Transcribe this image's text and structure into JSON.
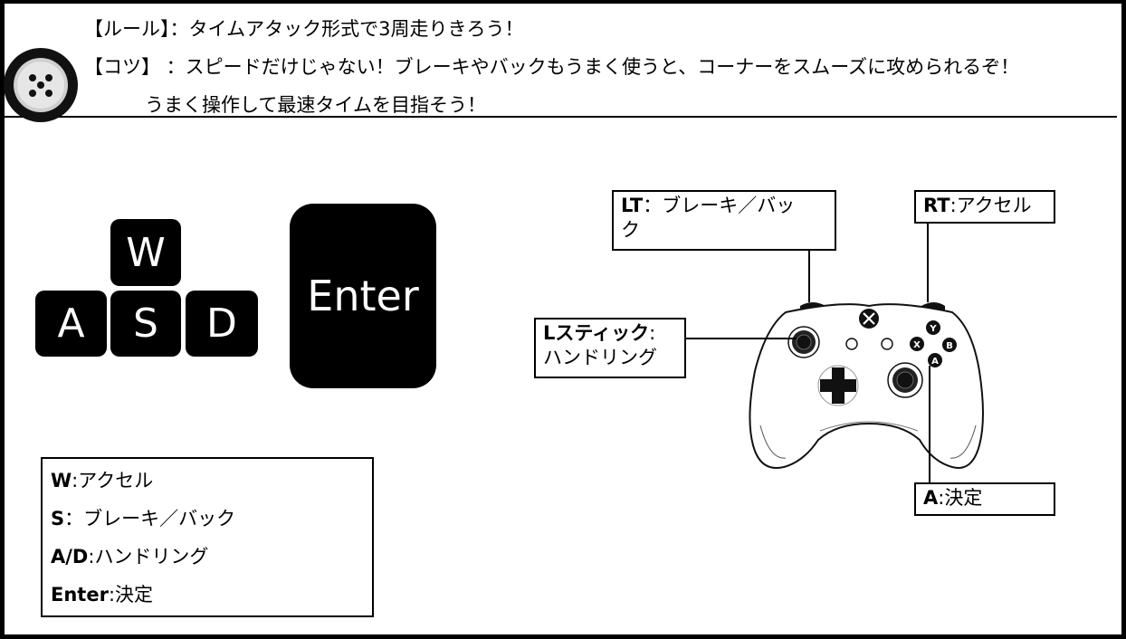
{
  "header": {
    "rule_line": "【ルール】：タイムアタック形式で3周走りきろう！",
    "tips_line": "【コツ】 ：スピードだけじゃない！ブレーキやバックもうまく使うと、コーナーをスムーズに攻められるぞ！",
    "tips_line2": "うまく操作して最速タイムを目指そう！",
    "icon": "tire-wheel-icon"
  },
  "keys": {
    "w": "W",
    "a": "A",
    "s": "S",
    "d": "D",
    "enter": "Enter"
  },
  "legend": [
    {
      "key": "W",
      "sep": ":",
      "action": "アクセル"
    },
    {
      "key": "S",
      "sep": "：",
      "action": "ブレーキ／バック"
    },
    {
      "key": "A/D",
      "sep": ":",
      "action": "ハンドリング"
    },
    {
      "key": "Enter",
      "sep": ":",
      "action": "決定"
    }
  ],
  "controller": {
    "icon": "xbox-controller-icon",
    "lt": {
      "key": "LT",
      "sep": "：",
      "action": "ブレーキ／バッ",
      "action2": "ク"
    },
    "rt": {
      "key": "RT",
      "sep": ":",
      "action": "アクセル"
    },
    "lstick": {
      "key": "Lスティック",
      "sep": ":",
      "action": "ハンドリング"
    },
    "a": {
      "key": "A",
      "sep": ":",
      "action": "決定"
    },
    "face_buttons": [
      "Y",
      "X",
      "B",
      "A"
    ]
  }
}
